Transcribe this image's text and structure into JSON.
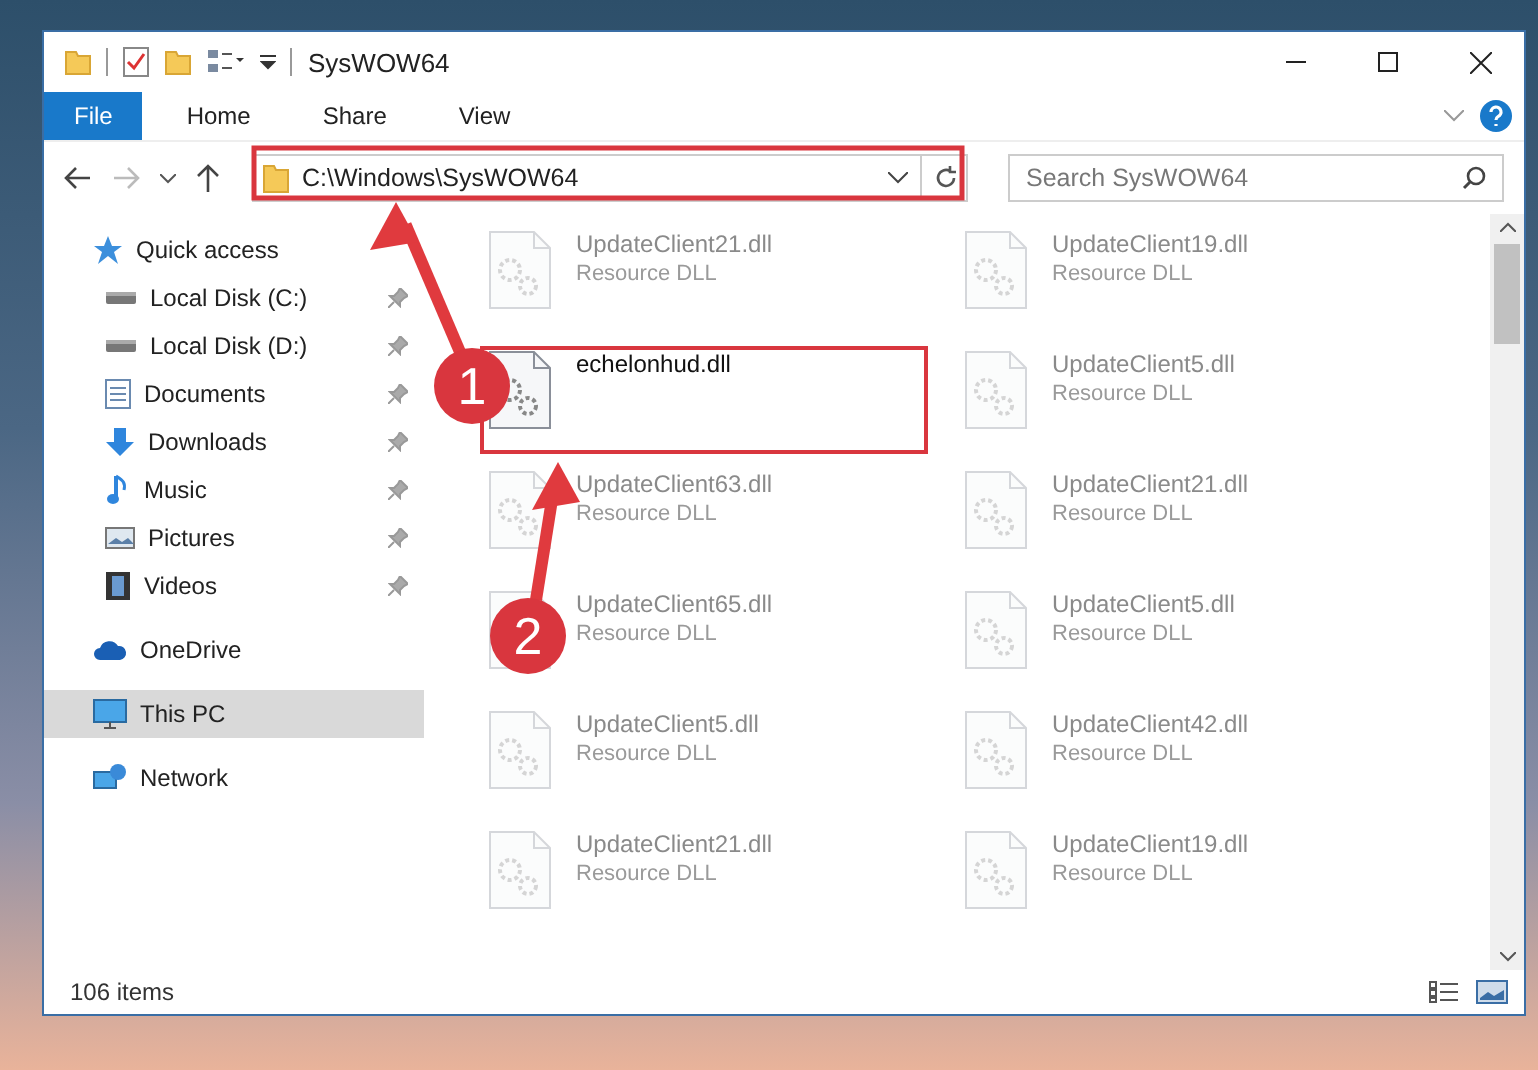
{
  "window": {
    "title": "SysWOW64"
  },
  "ribbon_tabs": [
    {
      "label": "File",
      "selected": true
    },
    {
      "label": "Home",
      "selected": false
    },
    {
      "label": "Share",
      "selected": false
    },
    {
      "label": "View",
      "selected": false
    }
  ],
  "address_bar": {
    "value": "C:\\Windows\\SysWOW64"
  },
  "search": {
    "placeholder": "Search SysWOW64"
  },
  "sidebar": {
    "items": [
      {
        "label": "Quick access",
        "kind": "star",
        "pinned": false,
        "level_indent": false,
        "selected": false
      },
      {
        "label": "Local Disk (C:)",
        "kind": "drive",
        "pinned": true,
        "level_indent": true,
        "selected": false
      },
      {
        "label": "Local Disk (D:)",
        "kind": "drive",
        "pinned": true,
        "level_indent": true,
        "selected": false
      },
      {
        "label": "Documents",
        "kind": "document",
        "pinned": true,
        "level_indent": true,
        "selected": false
      },
      {
        "label": "Downloads",
        "kind": "download",
        "pinned": true,
        "level_indent": true,
        "selected": false
      },
      {
        "label": "Music",
        "kind": "music",
        "pinned": true,
        "level_indent": true,
        "selected": false
      },
      {
        "label": "Pictures",
        "kind": "picture",
        "pinned": true,
        "level_indent": true,
        "selected": false
      },
      {
        "label": "Videos",
        "kind": "video",
        "pinned": true,
        "level_indent": true,
        "selected": false
      },
      {
        "label": "OneDrive",
        "kind": "cloud",
        "pinned": false,
        "level_indent": false,
        "selected": false
      },
      {
        "label": "This PC",
        "kind": "pc",
        "pinned": false,
        "level_indent": false,
        "selected": true
      },
      {
        "label": "Network",
        "kind": "network",
        "pinned": false,
        "level_indent": false,
        "selected": false
      }
    ]
  },
  "files": [
    {
      "name": "UpdateClient21.dll",
      "type": "Resource DLL",
      "faded": true,
      "highlighted": false
    },
    {
      "name": "UpdateClient19.dll",
      "type": "Resource DLL",
      "faded": true,
      "highlighted": false
    },
    {
      "name": "echelonhud.dll",
      "faded": false,
      "highlighted": true
    },
    {
      "name": "UpdateClient5.dll",
      "type": "Resource DLL",
      "faded": true,
      "highlighted": false
    },
    {
      "name": "UpdateClient63.dll",
      "type": "Resource DLL",
      "faded": true,
      "highlighted": false
    },
    {
      "name": "UpdateClient21.dll",
      "type": "Resource DLL",
      "faded": true,
      "highlighted": false
    },
    {
      "name": "UpdateClient65.dll",
      "type": "Resource DLL",
      "faded": true,
      "highlighted": false
    },
    {
      "name": "UpdateClient5.dll",
      "type": "Resource DLL",
      "faded": true,
      "highlighted": false
    },
    {
      "name": "UpdateClient5.dll",
      "type": "Resource DLL",
      "faded": true,
      "highlighted": false
    },
    {
      "name": "UpdateClient42.dll",
      "type": "Resource DLL",
      "faded": true,
      "highlighted": false
    },
    {
      "name": "UpdateClient21.dll",
      "type": "Resource DLL",
      "faded": true,
      "highlighted": false
    },
    {
      "name": "UpdateClient19.dll",
      "type": "Resource DLL",
      "faded": true,
      "highlighted": false
    }
  ],
  "status_bar": {
    "text": "106 items"
  },
  "annotations": [
    {
      "label": "1"
    },
    {
      "label": "2"
    }
  ]
}
